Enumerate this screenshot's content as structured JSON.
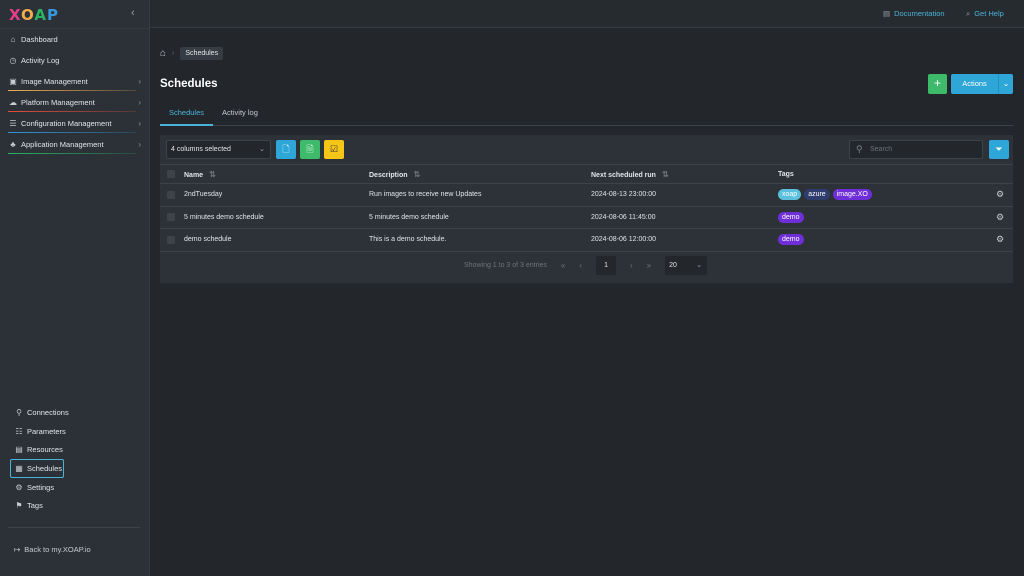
{
  "logo": {
    "x": "X",
    "o": "O",
    "a": "A",
    "p": "P"
  },
  "sidebar": {
    "collapse": "‹",
    "items": [
      {
        "label": "Dashboard",
        "icon": "home-icon",
        "glyph": "⌂",
        "chevron": false,
        "bar_color": ""
      },
      {
        "label": "Activity Log",
        "icon": "clock-icon",
        "glyph": "◷",
        "chevron": false,
        "bar_color": ""
      },
      {
        "label": "Image Management",
        "icon": "image-icon",
        "glyph": "▣",
        "chevron": true,
        "bar_color": "#f0ad4e"
      },
      {
        "label": "Platform Management",
        "icon": "cloud-icon",
        "glyph": "☁",
        "chevron": true,
        "bar_color": "#e74c3c"
      },
      {
        "label": "Configuration Management",
        "icon": "sliders-icon",
        "glyph": "☰",
        "chevron": true,
        "bar_color": "#3498db"
      },
      {
        "label": "Application Management",
        "icon": "apps-icon",
        "glyph": "♣",
        "chevron": true,
        "bar_color": "#28b463"
      }
    ],
    "bottom_items": [
      {
        "label": "Connections",
        "icon": "link-icon",
        "glyph": "⚲"
      },
      {
        "label": "Parameters",
        "icon": "list-icon",
        "glyph": "☷"
      },
      {
        "label": "Resources",
        "icon": "box-icon",
        "glyph": "▤"
      },
      {
        "label": "Schedules",
        "icon": "calendar-icon",
        "glyph": "▦",
        "active": true
      },
      {
        "label": "Settings",
        "icon": "gear-icon",
        "glyph": "⚙"
      },
      {
        "label": "Tags",
        "icon": "bookmark-icon",
        "glyph": "⚑"
      }
    ],
    "back_label": "Back to my.XOAP.io"
  },
  "topbar": {
    "documentation": "Documentation",
    "help": "Get Help"
  },
  "breadcrumb": {
    "current": "Schedules"
  },
  "page": {
    "title": "Schedules",
    "add": "+",
    "actions": "Actions"
  },
  "tabs": [
    {
      "label": "Schedules",
      "active": true
    },
    {
      "label": "Activity log",
      "active": false
    }
  ],
  "toolbar": {
    "columns_selected": "4 columns selected",
    "search_placeholder": "Search"
  },
  "table": {
    "headers": {
      "name": "Name",
      "description": "Description",
      "next_run": "Next scheduled run",
      "tags": "Tags"
    },
    "rows": [
      {
        "name": "2ndTuesday",
        "description": "Run images to receive new Updates",
        "next_run": "2024-08-13 23:00:00",
        "tags": [
          {
            "label": "xoap",
            "color": "#5bc0de"
          },
          {
            "label": "azure",
            "color": "#2f3d6e"
          },
          {
            "label": "image.XO",
            "color": "#6f2fd8"
          }
        ]
      },
      {
        "name": "5 minutes demo schedule",
        "description": "5 minutes demo schedule",
        "next_run": "2024-08-06 11:45:00",
        "tags": [
          {
            "label": "demo",
            "color": "#6f2fd8"
          }
        ]
      },
      {
        "name": "demo schedule",
        "description": "This is a demo schedule.",
        "next_run": "2024-08-06 12:00:00",
        "tags": [
          {
            "label": "demo",
            "color": "#6f2fd8"
          }
        ]
      }
    ]
  },
  "pager": {
    "summary": "Showing 1 to 3 of 3 entries",
    "current_page": "1",
    "page_size": "20"
  },
  "colors": {
    "accent": "#2fa6d8",
    "add_green": "#3dbb6b",
    "export_green": "#3dbb6b",
    "yellow": "#f5c518"
  }
}
